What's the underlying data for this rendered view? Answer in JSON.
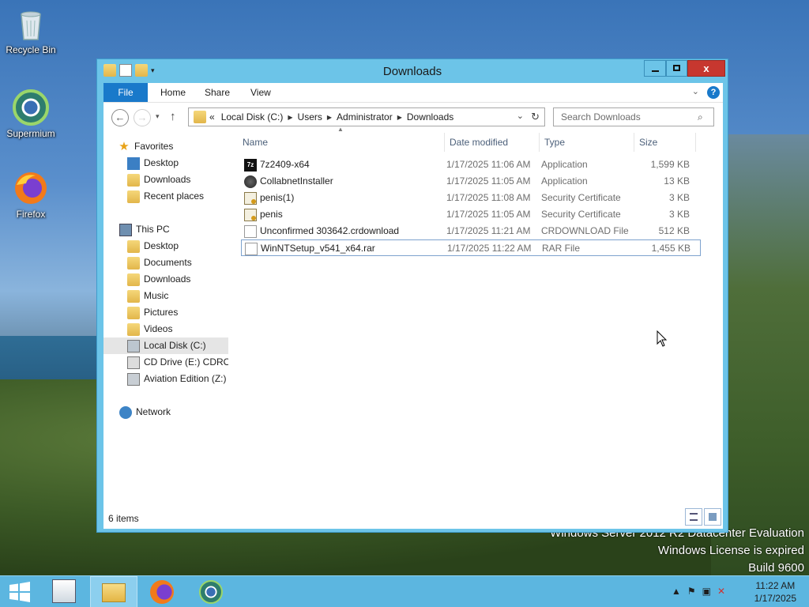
{
  "desktop": {
    "icons": [
      {
        "label": "Recycle Bin",
        "icon": "recycle-bin-icon"
      },
      {
        "label": "Supermium",
        "icon": "supermium-icon"
      },
      {
        "label": "Firefox",
        "icon": "firefox-icon"
      }
    ],
    "watermark": [
      "Windows Server 2012 R2 Datacenter Evaluation",
      "Windows License is expired",
      "Build 9600"
    ]
  },
  "window": {
    "title": "Downloads",
    "controls": {
      "close": "x"
    },
    "ribbon": {
      "file": "File",
      "tabs": [
        "Home",
        "Share",
        "View"
      ],
      "help": "?"
    },
    "address": {
      "overflow": "«",
      "crumbs": [
        "Local Disk (C:)",
        "Users",
        "Administrator",
        "Downloads"
      ]
    },
    "search_placeholder": "Search Downloads",
    "nav": {
      "favorites": "Favorites",
      "favorites_items": [
        "Desktop",
        "Downloads",
        "Recent places"
      ],
      "this_pc": "This PC",
      "pc_items": [
        "Desktop",
        "Documents",
        "Downloads",
        "Music",
        "Pictures",
        "Videos",
        "Local Disk (C:)",
        "CD Drive (E:) CDROM",
        "Aviation Edition (Z:)"
      ],
      "network": "Network"
    },
    "columns": {
      "name": "Name",
      "date": "Date modified",
      "type": "Type",
      "size": "Size"
    },
    "files": [
      {
        "name": "7z2409-x64",
        "date": "1/17/2025 11:06 AM",
        "type": "Application",
        "size": "1,599 KB",
        "icon": "7zip-icon"
      },
      {
        "name": "CollabnetInstaller",
        "date": "1/17/2025 11:05 AM",
        "type": "Application",
        "size": "13 KB",
        "icon": "installer-icon"
      },
      {
        "name": "penis(1)",
        "date": "1/17/2025 11:08 AM",
        "type": "Security Certificate",
        "size": "3 KB",
        "icon": "certificate-icon"
      },
      {
        "name": "penis",
        "date": "1/17/2025 11:05 AM",
        "type": "Security Certificate",
        "size": "3 KB",
        "icon": "certificate-icon"
      },
      {
        "name": "Unconfirmed 303642.crdownload",
        "date": "1/17/2025 11:21 AM",
        "type": "CRDOWNLOAD File",
        "size": "512 KB",
        "icon": "blank-file-icon"
      },
      {
        "name": "WinNTSetup_v541_x64.rar",
        "date": "1/17/2025 11:22 AM",
        "type": "RAR File",
        "size": "1,455 KB",
        "icon": "blank-file-icon"
      }
    ],
    "status": "6 items"
  },
  "taskbar": {
    "time": "11:22 AM",
    "date": "1/17/2025"
  },
  "colors": {
    "accent": "#1979ca",
    "window_frame": "#6cc4e8",
    "close": "#c7372f",
    "taskbar": "#5cb6e0"
  }
}
